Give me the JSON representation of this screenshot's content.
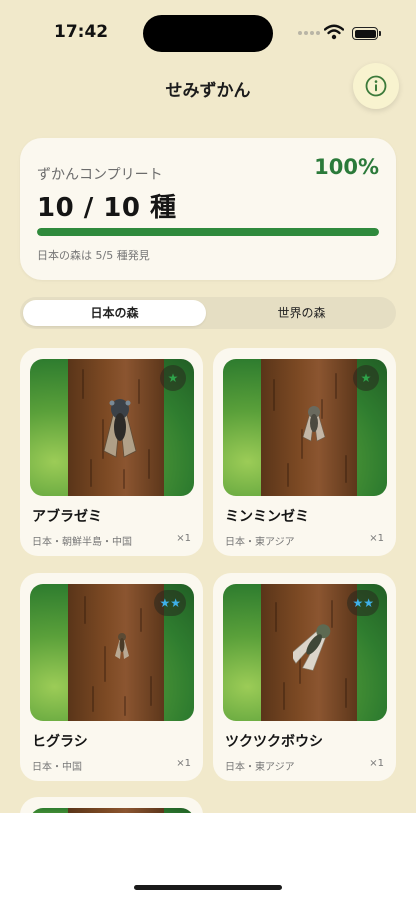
{
  "status": {
    "time": "17:42"
  },
  "header": {
    "title": "せみずかん",
    "info_icon": "info-circle-icon"
  },
  "progress": {
    "heading": "ずかんコンプリート",
    "percent_label": "100%",
    "count_label": "10 / 10 種",
    "sub_label": "日本の森は 5/5 種発見",
    "fraction": 1.0
  },
  "tabs": [
    {
      "label": "日本の森",
      "selected": true
    },
    {
      "label": "世界の森",
      "selected": false
    }
  ],
  "species": [
    {
      "name": "アブラゼミ",
      "region": "日本・朝鮮半島・中国",
      "count": "×1",
      "rarity": "★",
      "rarity_color": "#2ea34a"
    },
    {
      "name": "ミンミンゼミ",
      "region": "日本・東アジア",
      "count": "×1",
      "rarity": "★",
      "rarity_color": "#2ea34a"
    },
    {
      "name": "ヒグラシ",
      "region": "日本・中国",
      "count": "×1",
      "rarity": "★★",
      "rarity_color": "#3fb0e8"
    },
    {
      "name": "ツクツクボウシ",
      "region": "日本・東アジア",
      "count": "×1",
      "rarity": "★★",
      "rarity_color": "#3fb0e8"
    }
  ],
  "colors": {
    "background": "#f1e9cb",
    "accent_green": "#2f8a3c",
    "card": "#fbf8ef"
  }
}
